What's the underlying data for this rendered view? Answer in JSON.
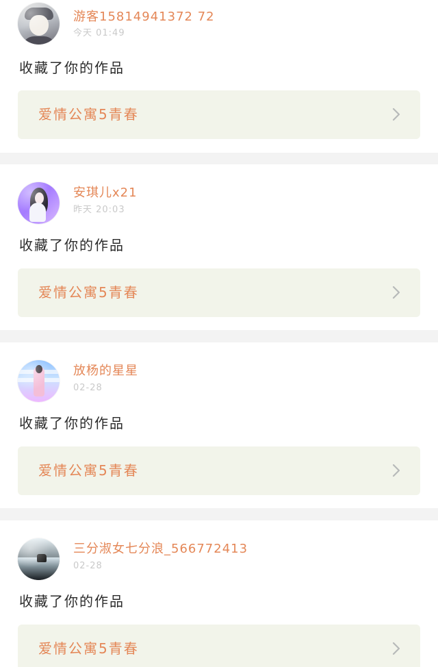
{
  "feed": {
    "items": [
      {
        "username": "游客15814941372 72",
        "time": "今天 01:49",
        "action": "收藏了你的作品",
        "work_title": "爱情公寓5青春"
      },
      {
        "username": "安琪儿x21",
        "time": "昨天 20:03",
        "action": "收藏了你的作品",
        "work_title": "爱情公寓5青春"
      },
      {
        "username": "放杨的星星",
        "time": "02-28",
        "action": "收藏了你的作品",
        "work_title": "爱情公寓5青春"
      },
      {
        "username": "三分淑女七分浪_566772413",
        "time": "02-28",
        "action": "收藏了你的作品",
        "work_title": "爱情公寓5青春"
      }
    ]
  },
  "colors": {
    "accent": "#e48757",
    "work_card_bg": "#f2f4ea",
    "page_bg": "#f3f3f3",
    "time_text": "#c9c9c9",
    "chevron": "#b7b9b9"
  },
  "icons": {
    "chevron": "chevron-right-icon"
  }
}
